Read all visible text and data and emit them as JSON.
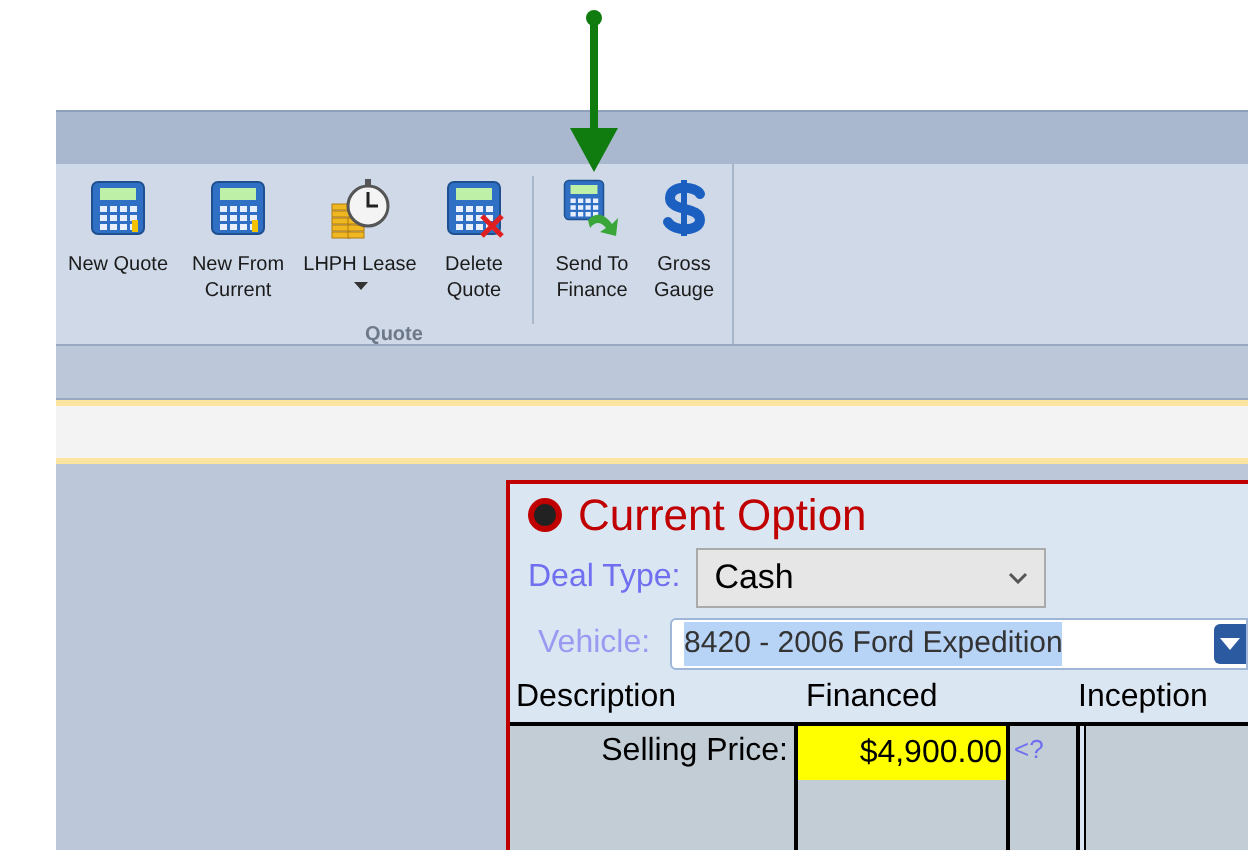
{
  "ribbon": {
    "group_label": "Quote",
    "buttons": [
      {
        "label": "New Quote",
        "kind": "calculator",
        "dropdown": false
      },
      {
        "label": "New From Current",
        "kind": "calculator",
        "dropdown": false
      },
      {
        "label": "LHPH Lease",
        "kind": "stopwatch",
        "dropdown": true
      },
      {
        "label": "Delete Quote",
        "kind": "calculator-delete",
        "dropdown": false
      },
      {
        "label": "Send To Finance",
        "kind": "calculator-send",
        "dropdown": false
      },
      {
        "label": "Gross Gauge",
        "kind": "dollar",
        "dropdown": false
      }
    ]
  },
  "option": {
    "title": "Current Option",
    "selected": true,
    "deal_type": {
      "label": "Deal Type:",
      "value": "Cash"
    },
    "vehicle": {
      "label": "Vehicle:",
      "value": "8420 - 2006 Ford Expedition"
    },
    "table": {
      "columns": [
        "Description",
        "Financed",
        "Inception"
      ],
      "rows": [
        {
          "label": "Selling Price:",
          "financed": "$4,900.00",
          "hint": "<?"
        }
      ]
    }
  }
}
